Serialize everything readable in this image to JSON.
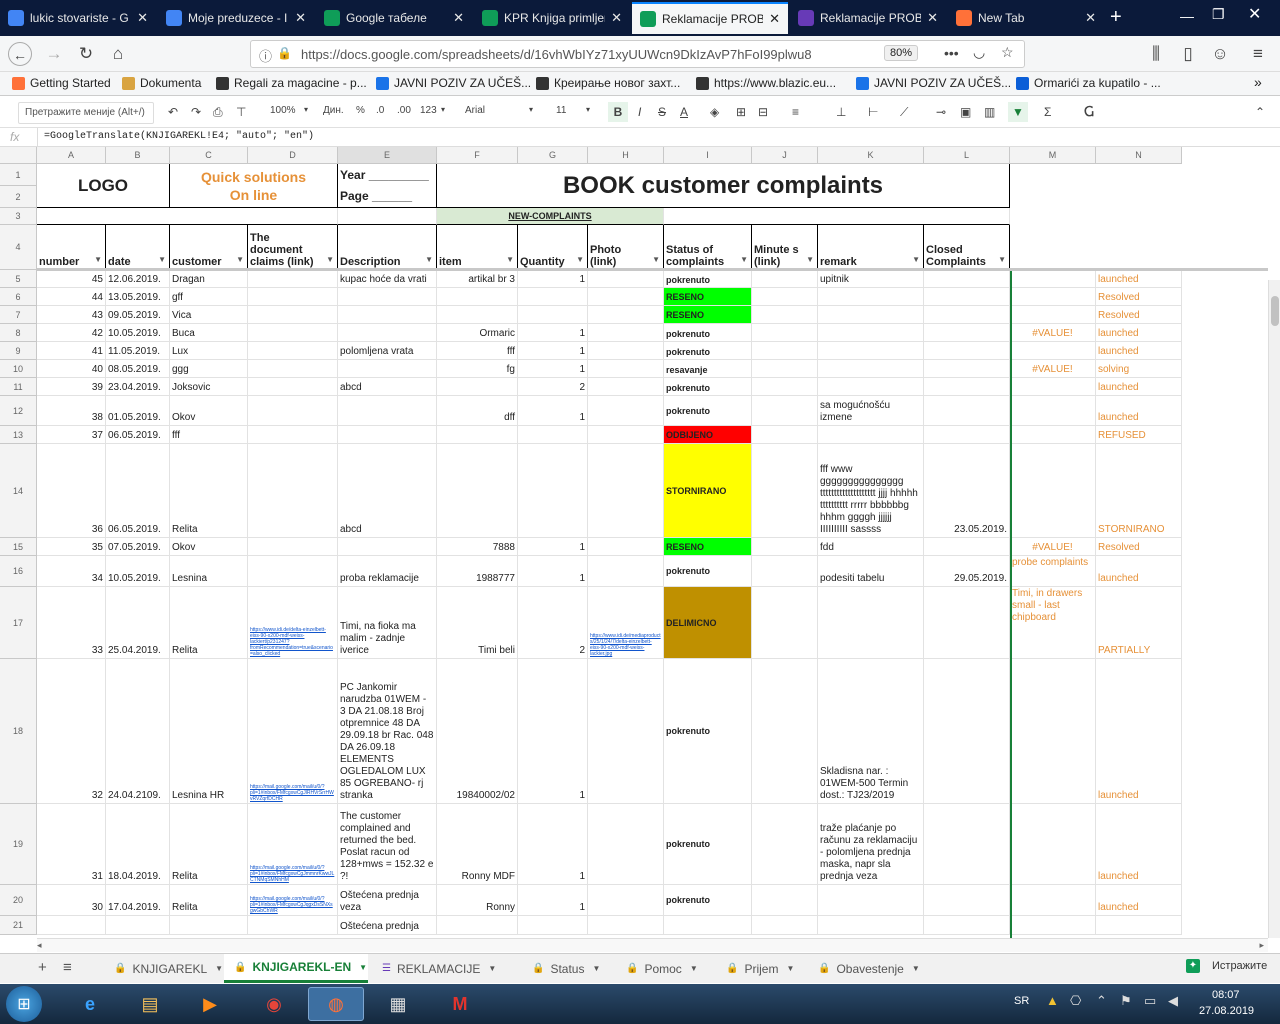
{
  "browser": {
    "tabs": [
      {
        "label": "lukic stovariste - G",
        "icon": "google-icon",
        "color": "#4285f4"
      },
      {
        "label": "Moje preduzece - I",
        "icon": "docs-icon",
        "color": "#4285f4"
      },
      {
        "label": "Google табеле",
        "icon": "sheets-icon",
        "color": "#0f9d58"
      },
      {
        "label": "KPR Knjiga primljen",
        "icon": "sheets-icon",
        "color": "#0f9d58"
      },
      {
        "label": "Reklamacije PROB",
        "icon": "sheets-icon",
        "color": "#0f9d58",
        "active": true
      },
      {
        "label": "Reklamacije PROB",
        "icon": "forms-icon",
        "color": "#673ab7"
      },
      {
        "label": "New Tab",
        "icon": "firefox-icon",
        "color": "#ff7139"
      }
    ],
    "url": "https://docs.google.com/spreadsheets/d/16vhWbIYz71xyUUWcn9DkIzAvP7hFoI99plwu8",
    "zoom": "80%",
    "bookmarks": [
      "Getting Started",
      "Dokumenta",
      "Regali za magacine - p...",
      "JAVNI POZIV ZA UČEŠ...",
      "Креирање новог захт...",
      "https://www.blazic.eu...",
      "JAVNI POZIV ZA UČEŠ...",
      "Ormarići za kupatilo - ..."
    ]
  },
  "toolbar": {
    "menu_search": "Претражите меније (Alt+/)",
    "zoom": "100%",
    "currency": "Дин.",
    "percent": "%",
    "dec_less": ".0",
    "dec_more": ".00",
    "format": "123",
    "font": "Arial",
    "size": "11"
  },
  "formula": {
    "fx": "fx",
    "text": "=GoogleTranslate(KNJIGAREKL!E4; \"auto\"; \"en\")"
  },
  "columns": [
    "A",
    "B",
    "C",
    "D",
    "E",
    "F",
    "G",
    "H",
    "I",
    "J",
    "K",
    "L",
    "M",
    "N"
  ],
  "header": {
    "logo": "LOGO",
    "quick": "Quick solutions",
    "online": "On line",
    "year": "Year _________",
    "page": "Page    ______",
    "title": "BOOK customer complaints",
    "new_complaints": "NEW-COMPLAINTS",
    "col_number": "number",
    "col_date": "date",
    "col_customer": "customer",
    "col_doc": "The document claims (link)",
    "col_desc": "Description",
    "col_item": "item",
    "col_qty": "Quantity",
    "col_photo": "Photo (link)",
    "col_status": "Status of complaints",
    "col_minutes": "Minute s (link)",
    "col_remark": "remark",
    "col_closed": "Closed Complaints"
  },
  "rows": [
    {
      "rn": "5",
      "a": "45",
      "b": "12.06.2019.",
      "c": "Dragan",
      "d": "",
      "e": "kupac hoće da vrati",
      "f": "artikal br 3",
      "g": "1",
      "h": "",
      "i": "pokrenuto",
      "k": "upitnik",
      "l": "",
      "m": "",
      "n": "launched"
    },
    {
      "rn": "6",
      "a": "44",
      "b": "13.05.2019.",
      "c": "gff",
      "d": "",
      "e": "",
      "f": "",
      "g": "",
      "h": "",
      "i": "RESENO",
      "k": "",
      "l": "",
      "m": "",
      "n": "Resolved"
    },
    {
      "rn": "7",
      "a": "43",
      "b": "09.05.2019.",
      "c": "Vica",
      "d": "",
      "e": "",
      "f": "",
      "g": "",
      "h": "",
      "i": "RESENO",
      "k": "",
      "l": "",
      "m": "",
      "n": "Resolved"
    },
    {
      "rn": "8",
      "a": "42",
      "b": "10.05.2019.",
      "c": "Buca",
      "d": "",
      "e": "",
      "f": "Ormaric",
      "g": "1",
      "h": "",
      "i": "pokrenuto",
      "k": "",
      "l": "",
      "m": "#VALUE!",
      "n": "launched"
    },
    {
      "rn": "9",
      "a": "41",
      "b": "11.05.2019.",
      "c": "Lux",
      "d": "",
      "e": "polomljena vrata",
      "f": "fff",
      "g": "1",
      "h": "",
      "i": "pokrenuto",
      "k": "",
      "l": "",
      "m": "",
      "n": "launched"
    },
    {
      "rn": "10",
      "a": "40",
      "b": "08.05.2019.",
      "c": "ggg",
      "d": "",
      "e": "",
      "f": "fg",
      "g": "1",
      "h": "",
      "i": "resavanje",
      "k": "",
      "l": "",
      "m": "#VALUE!",
      "n": "solving"
    },
    {
      "rn": "11",
      "a": "39",
      "b": "23.04.2019.",
      "c": "Joksovic",
      "d": "",
      "e": "abcd",
      "f": "",
      "g": "2",
      "h": "",
      "i": "pokrenuto",
      "k": "",
      "l": "",
      "m": "",
      "n": "launched"
    },
    {
      "rn": "12",
      "a": "38",
      "b": "01.05.2019.",
      "c": "Okov",
      "d": "",
      "e": "",
      "f": "dff",
      "g": "1",
      "h": "",
      "i": "pokrenuto",
      "k": "sa mogućnošću izmene",
      "l": "",
      "m": "",
      "n": "launched"
    },
    {
      "rn": "13",
      "a": "37",
      "b": "06.05.2019.",
      "c": "fff",
      "d": "",
      "e": "",
      "f": "",
      "g": "",
      "h": "",
      "i": "ODBIJENO",
      "k": "",
      "l": "",
      "m": "",
      "n": "REFUSED"
    },
    {
      "rn": "14",
      "a": "36",
      "b": "06.05.2019.",
      "c": "Relita",
      "d": "",
      "e": "abcd",
      "f": "",
      "g": "",
      "h": "",
      "i": "STORNIRANO",
      "k": "fff www ggggggggggggggg tttttttttttttttttttt jjjj hhhhh tttttttttt rrrrr bbbbbbg hhhm ggggh jjjjjj IIIIIIIIII sassss",
      "l": "23.05.2019.",
      "m": "",
      "n": "STORNIRANO"
    },
    {
      "rn": "15",
      "a": "35",
      "b": "07.05.2019.",
      "c": "Okov",
      "d": "",
      "e": "",
      "f": "7888",
      "g": "1",
      "h": "",
      "i": "RESENO",
      "k": "fdd",
      "l": "",
      "m": "#VALUE!",
      "n": "Resolved"
    },
    {
      "rn": "16",
      "a": "34",
      "b": "10.05.2019.",
      "c": "Lesnina",
      "d": "",
      "e": "proba reklamacije",
      "f": "1988777",
      "g": "1",
      "h": "",
      "i": "pokrenuto",
      "k": "podesiti tabelu",
      "l": "29.05.2019.",
      "m": "probe complaints",
      "n": "launched"
    },
    {
      "rn": "17",
      "a": "33",
      "b": "25.04.2019.",
      "c": "Relita",
      "d": "https://www.idi.de/delta-einzelbett-eiss-90-x200-mdf-weiss-lackiert/p231247?fromRecommendation=true&scenario=also_clicked",
      "e": "Timi, na fioka ma malim - zadnje iverice",
      "f": "Timi beli",
      "g": "2",
      "h": "https://www.idi.de/mediaproducts/25/1/24/7/delta-einzelbett-eiss-90-x200-mdf-weiss-lackier.jpg",
      "i": "DELIMICNO",
      "k": "",
      "l": "",
      "m": "Timi, in drawers small - last chipboard",
      "n": "PARTIALLY"
    },
    {
      "rn": "18",
      "a": "32",
      "b": "24.04.2109.",
      "c": "Lesnina HR",
      "d": "https://mail.google.com/mail/u/0/?pli=1#inbox/FMfcgxwCgJlRHVrSrrHWvRVZqrfDCHR",
      "e": "PC Jankomir narudzba 01WEM - 3 DA 21.08.18 Broj otpremnice 48 DA 29.09.18 br Rac. 048 DA 26.09.18 ELEMENTS OGLEDALOM LUX 85 OGREBANO- rj stranka",
      "f": "19840002/02",
      "g": "1",
      "h": "",
      "i": "pokrenuto",
      "k": "Skladisna nar. : 01WEM-500 Termin dost.: TJ23/2019",
      "l": "",
      "m": "",
      "n": "launched"
    },
    {
      "rn": "19",
      "a": "31",
      "b": "18.04.2019.",
      "c": "Relita",
      "d": "https://mail.google.com/mail/u/0/?pli=1#inbox/FMfcgxwCgJmmnrKwwJLCTNMqSMNhHM",
      "e": "The customer complained and returned the bed. Poslat racun od 128+mws = 152.32 e ?!",
      "f": "Ronny MDF",
      "g": "1",
      "h": "",
      "i": "pokrenuto",
      "k": "traže plaćanje po računu za reklamaciju - polomljena prednja maska, napr sla prednja veza",
      "l": "",
      "m": "",
      "n": "launched"
    },
    {
      "rn": "20",
      "a": "30",
      "b": "17.04.2019.",
      "c": "Relita",
      "d": "https://mail.google.com/mail/u/0/?pli=1#inbox/FMfcgxwCgJqgxDsSNXsgwGbChWR",
      "e": "Oštećena prednja veza",
      "f": "Ronny",
      "g": "1",
      "h": "",
      "i": "pokrenuto",
      "k": "",
      "l": "",
      "m": "",
      "n": "launched"
    },
    {
      "rn": "21",
      "a": "",
      "b": "",
      "c": "",
      "d": "",
      "e": "Oštećena prednja",
      "f": "",
      "g": "",
      "h": "",
      "i": "",
      "k": "",
      "l": "",
      "m": "",
      "n": ""
    }
  ],
  "status_colors": {
    "RESENO": "#00ff00",
    "ODBIJENO": "#ff0000",
    "STORNIRANO": "#ffff00",
    "DELIMICNO": "#bf9000"
  },
  "sheets": [
    "KNJIGAREKL",
    "KNJIGAREKL-EN",
    "REKLAMACIJE",
    "Status",
    "Pomoc",
    "Prijem",
    "Obavestenje"
  ],
  "explore_label": "Истражите",
  "taskbar": {
    "lang": "SR",
    "time": "08:07",
    "date": "27.08.2019"
  }
}
